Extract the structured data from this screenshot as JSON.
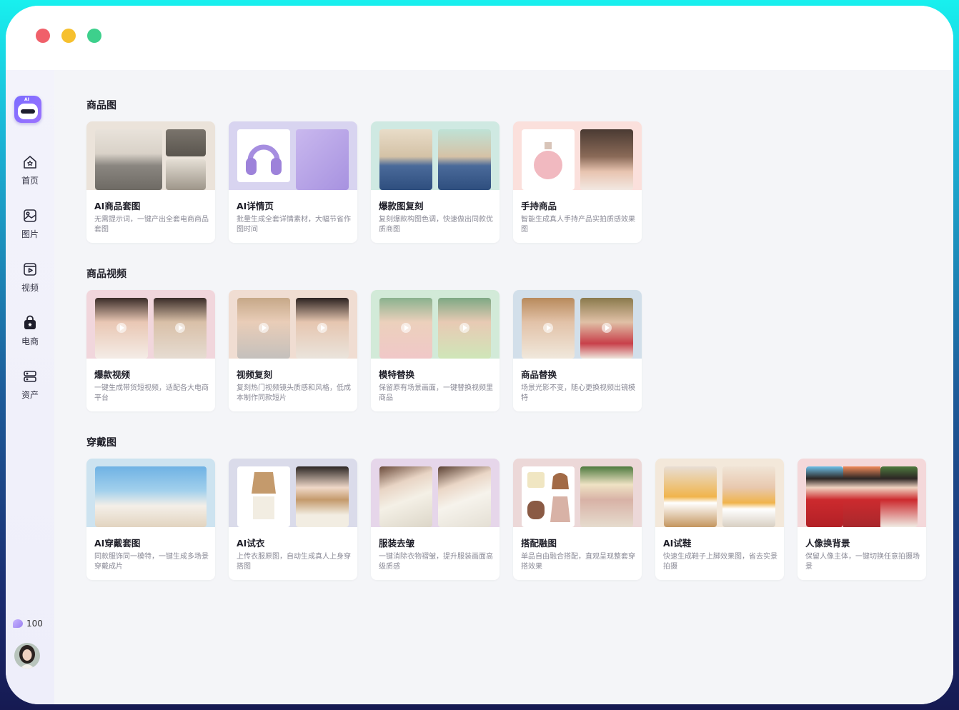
{
  "window_controls": [
    "close",
    "minimize",
    "maximize"
  ],
  "sidebar": {
    "logo_tag": "AI",
    "items": [
      {
        "label": "首页",
        "icon": "home-icon"
      },
      {
        "label": "图片",
        "icon": "image-icon"
      },
      {
        "label": "视频",
        "icon": "video-icon"
      },
      {
        "label": "电商",
        "icon": "shopping-bag-icon"
      },
      {
        "label": "资产",
        "icon": "storage-icon"
      }
    ],
    "credits": "100"
  },
  "sections": [
    {
      "title": "商品图",
      "cards": [
        {
          "title": "AI商品套图",
          "desc": "无需提示词，一键产出全套电商商品套图"
        },
        {
          "title": "AI详情页",
          "desc": "批量生成全套详情素材，大幅节省作图时间"
        },
        {
          "title": "爆款图复刻",
          "desc": "复刻爆款构图色调，快速做出同款优质商图"
        },
        {
          "title": "手持商品",
          "desc": "智能生成真人手持产品实拍质感效果图"
        }
      ]
    },
    {
      "title": "商品视频",
      "cards": [
        {
          "title": "爆款视频",
          "desc": "一键生成带货短视频，适配各大电商平台"
        },
        {
          "title": "视频复刻",
          "desc": "复刻热门视频镜头质感和风格，低成本制作同款短片"
        },
        {
          "title": "模特替换",
          "desc": "保留原有场景画面，一键替换视频里商品"
        },
        {
          "title": "商品替换",
          "desc": "场景光影不变，随心更换视频出镜模特"
        }
      ]
    },
    {
      "title": "穿戴图",
      "cards": [
        {
          "title": "AI穿戴套图",
          "desc": "同款服饰同一模特，一键生成多场景穿戴成片"
        },
        {
          "title": "AI试衣",
          "desc": "上传衣服原图，自动生成真人上身穿搭图"
        },
        {
          "title": "服装去皱",
          "desc": "一键消除衣物褶皱，提升服装画面高级质感"
        },
        {
          "title": "搭配融图",
          "desc": "单品自由融合搭配，直观呈现整套穿搭效果"
        },
        {
          "title": "AI试鞋",
          "desc": "快速生成鞋子上脚效果图，省去实景拍摄"
        },
        {
          "title": "人像换背景",
          "desc": "保留人像主体，一键切换任意拍摄场景"
        }
      ]
    }
  ],
  "colors": {
    "accent": "#7b6cff",
    "window_bg": "#ffffff",
    "content_bg": "#f4f5f8",
    "sidebar_bg": "#f0f0fa"
  }
}
